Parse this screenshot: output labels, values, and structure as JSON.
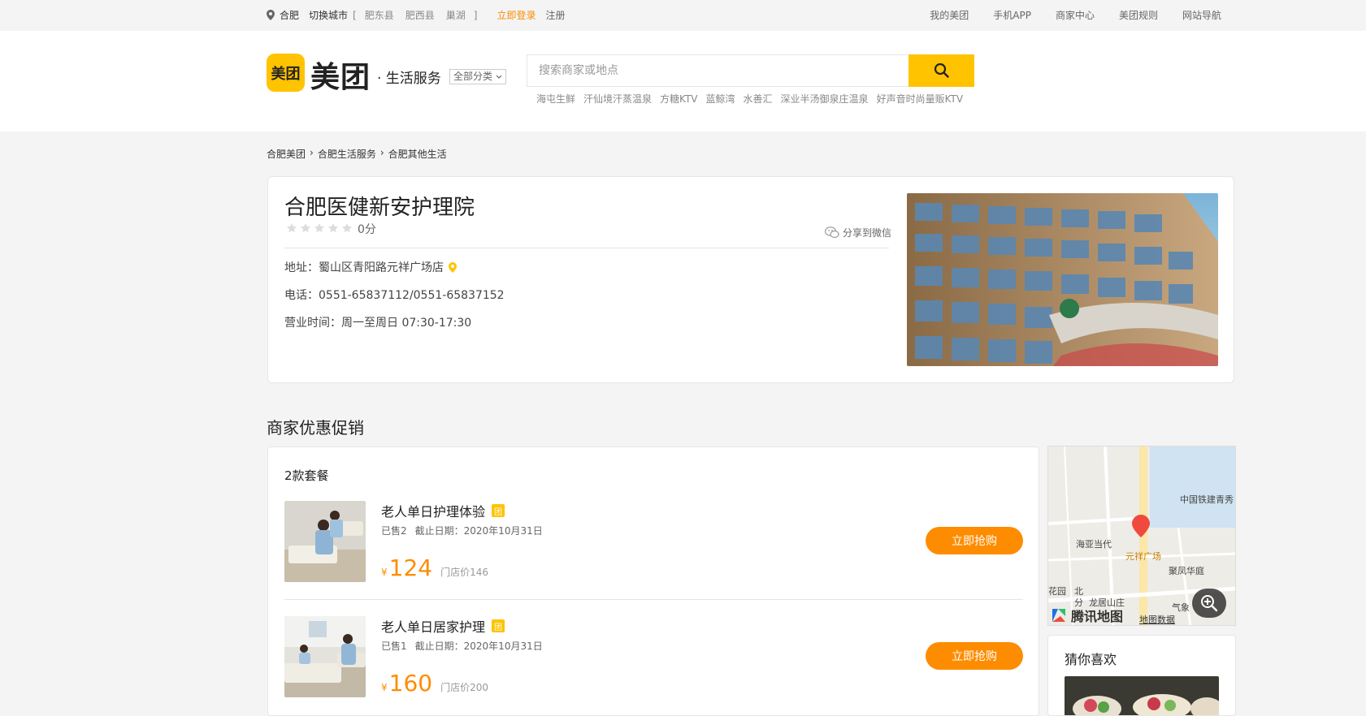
{
  "topbar": {
    "city": "合肥",
    "switch_city": "切换城市",
    "bracket_open": "[",
    "bracket_close": "]",
    "counties": [
      "肥东县",
      "肥西县",
      "巢湖"
    ],
    "login": "立即登录",
    "register": "注册",
    "links": [
      "我的美团",
      "手机APP",
      "商家中心",
      "美团规则",
      "网站导航"
    ]
  },
  "header": {
    "logo_mark": "美团",
    "logo_text": "美团",
    "sub_title": "· 生活服务",
    "category": "全部分类",
    "search_placeholder": "搜索商家或地点",
    "hot_words": [
      "海屯生鲜",
      "汗仙境汗蒸温泉",
      "方糖KTV",
      "蓝鲸湾",
      "水善汇",
      "深业半汤御泉庄温泉",
      "好声音时尚量贩KTV"
    ]
  },
  "breadcrumb": [
    "合肥美团",
    "合肥生活服务",
    "合肥其他生活"
  ],
  "shop": {
    "name": "合肥医健新安护理院",
    "rating": 0,
    "score_text": "0分",
    "share_label": "分享到微信",
    "address": "地址：蜀山区青阳路元祥广场店",
    "phone": "电话：0551-65837112/0551-65837152",
    "hours": "营业时间：周一至周日 07:30-17:30"
  },
  "promo": {
    "section_title": "商家优惠促销",
    "count_label": "2款套餐",
    "deals": [
      {
        "name": "老人单日护理体验",
        "badge": "团",
        "sold": "已售2",
        "deadline": "截止日期：2020年10月31日",
        "currency": "¥",
        "price": "124",
        "orig_price": "门店价146",
        "buy_label": "立即抢购"
      },
      {
        "name": "老人单日居家护理",
        "badge": "团",
        "sold": "已售1",
        "deadline": "截止日期：2020年10月31日",
        "currency": "¥",
        "price": "160",
        "orig_price": "门店价200",
        "buy_label": "立即抢购"
      }
    ]
  },
  "map": {
    "labels": [
      "中国铁建青秀",
      "海亚当代",
      "元祥广场",
      "聚凤华庭",
      "北",
      "分",
      "龙居山庄",
      "花园",
      "气象"
    ],
    "brand": "腾讯地图",
    "data_link": "地图数据"
  },
  "guess": {
    "title": "猜你喜欢"
  },
  "colors": {
    "brand_yellow": "#ffc300",
    "accent_orange": "#fe8c00"
  }
}
